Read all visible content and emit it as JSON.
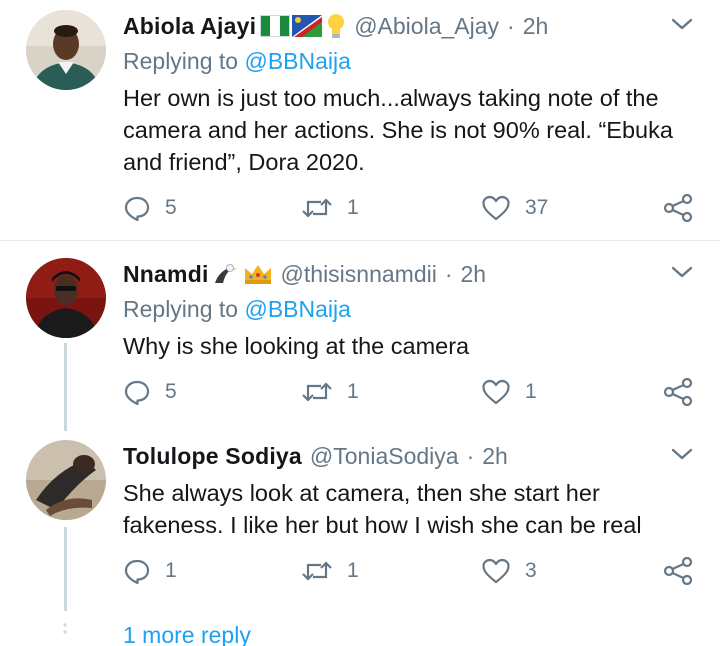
{
  "tweets": [
    {
      "name": "Abiola Ajayi",
      "handle": "@Abiola_Ajay",
      "time": "2h",
      "replying_label": "Replying to",
      "replying_to": "@BBNaija",
      "text": "Her own is just too much...always taking note of the camera and her actions. She is not 90% real. “Ebuka and friend”, Dora 2020.",
      "replies": "5",
      "retweets": "1",
      "likes": "37",
      "emoji": [
        "nigeria-flag",
        "namibia-flag",
        "light-bulb"
      ]
    },
    {
      "name": "Nnamdi",
      "handle": "@thisisnnamdii",
      "time": "2h",
      "replying_label": "Replying to",
      "replying_to": "@BBNaija",
      "text": "Why is she looking at the camera",
      "replies": "5",
      "retweets": "1",
      "likes": "1",
      "emoji": [
        "eagle",
        "crown"
      ]
    },
    {
      "name": "Tolulope Sodiya",
      "handle": "@ToniaSodiya",
      "time": "2h",
      "text": "She always look at camera, then she start her fakeness. I like her but how I wish she can be real",
      "replies": "1",
      "retweets": "1",
      "likes": "3"
    }
  ],
  "dot": "·",
  "more_replies": "1 more reply",
  "colors": {
    "text": "#14171a",
    "secondary": "#657786",
    "link": "#1da1f2",
    "divider": "#e6ecf0",
    "thread_line": "#ccd6dd"
  }
}
